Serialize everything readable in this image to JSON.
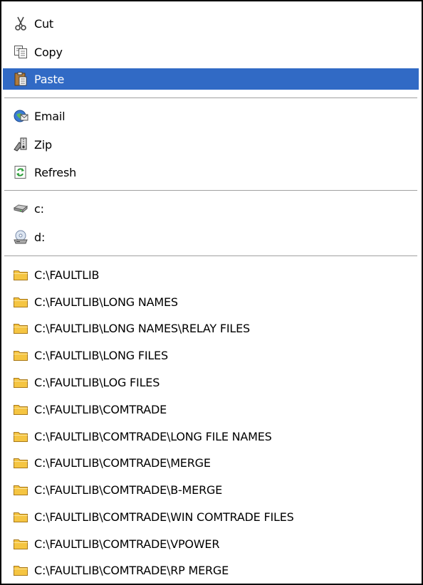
{
  "menu": {
    "edit": [
      {
        "label": "Cut",
        "icon": "scissors-icon"
      },
      {
        "label": "Copy",
        "icon": "copy-icon"
      },
      {
        "label": "Paste",
        "icon": "clipboard-icon",
        "highlighted": true
      }
    ],
    "actions": [
      {
        "label": "Email",
        "icon": "email-icon"
      },
      {
        "label": "Zip",
        "icon": "zip-icon"
      },
      {
        "label": "Refresh",
        "icon": "refresh-icon"
      }
    ],
    "drives": [
      {
        "label": "c:",
        "icon": "hard-drive-icon"
      },
      {
        "label": "d:",
        "icon": "cd-drive-icon"
      }
    ],
    "folders": [
      "C:\\FAULTLIB",
      "C:\\FAULTLIB\\LONG NAMES",
      "C:\\FAULTLIB\\LONG NAMES\\RELAY FILES",
      "C:\\FAULTLIB\\LONG FILES",
      "C:\\FAULTLIB\\LOG FILES",
      "C:\\FAULTLIB\\COMTRADE",
      "C:\\FAULTLIB\\COMTRADE\\LONG FILE NAMES",
      "C:\\FAULTLIB\\COMTRADE\\MERGE",
      "C:\\FAULTLIB\\COMTRADE\\B-MERGE",
      "C:\\FAULTLIB\\COMTRADE\\WIN COMTRADE FILES",
      "C:\\FAULTLIB\\COMTRADE\\VPOWER",
      "C:\\FAULTLIB\\COMTRADE\\RP MERGE"
    ]
  },
  "colors": {
    "highlight": "#316ac5",
    "folder": "#f5c542"
  }
}
